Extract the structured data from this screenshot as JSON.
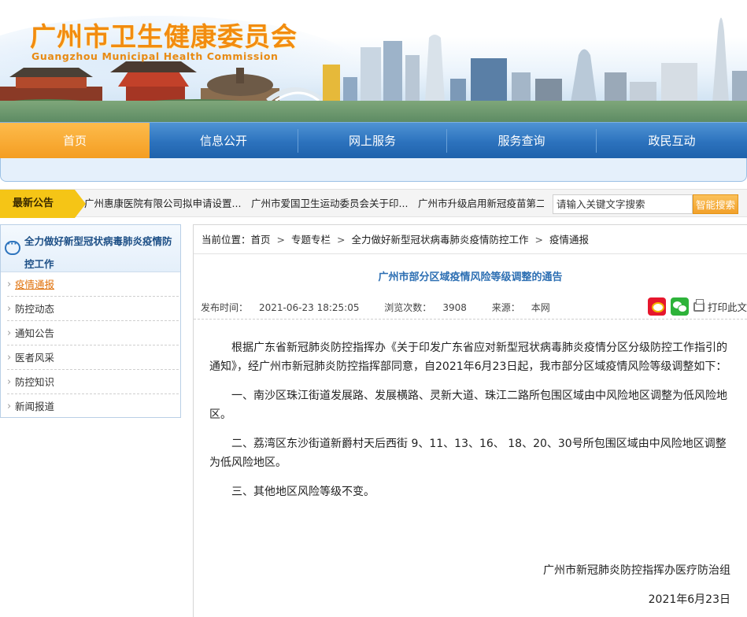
{
  "header": {
    "site_title": "广州市卫生健康委员会",
    "site_subtitle": "Guangzhou Municipal Health Commission"
  },
  "nav": {
    "items": [
      {
        "label": "首页",
        "active": true
      },
      {
        "label": "信息公开",
        "active": false
      },
      {
        "label": "网上服务",
        "active": false
      },
      {
        "label": "服务查询",
        "active": false
      },
      {
        "label": "政民互动",
        "active": false
      }
    ]
  },
  "notice": {
    "label": "最新公告",
    "items": [
      "广州惠康医院有限公司拟申请设置...",
      "广州市爱国卫生运动委员会关于印...",
      "广州市升级启用新冠疫苗第二"
    ]
  },
  "search": {
    "placeholder": "请输入关键文字搜索",
    "button_label": "智能搜索"
  },
  "sidebar": {
    "heading": "全力做好新型冠状病毒肺炎疫情防控工作",
    "items": [
      {
        "label": "疫情通报",
        "active": true
      },
      {
        "label": "防控动态",
        "active": false
      },
      {
        "label": "通知公告",
        "active": false
      },
      {
        "label": "医者风采",
        "active": false
      },
      {
        "label": "防控知识",
        "active": false
      },
      {
        "label": "新闻报道",
        "active": false
      }
    ]
  },
  "breadcrumb": {
    "prefix": "当前位置：",
    "items": [
      "首页",
      "专题专栏",
      "全力做好新型冠状病毒肺炎疫情防控工作",
      "疫情通报"
    ],
    "separator": ">"
  },
  "article": {
    "title": "广州市部分区域疫情风险等级调整的通告",
    "publish_label": "发布时间：",
    "publish_time": "2021-06-23 18:25:05",
    "views_label": "浏览次数：",
    "views": "3908",
    "source_label": "来源：",
    "source": "本网",
    "print_label": "打印此文",
    "paragraphs": [
      "根据广东省新冠肺炎防控指挥办《关于印发广东省应对新型冠状病毒肺炎疫情分区分级防控工作指引的通知》，经广州市新冠肺炎防控指挥部同意，自2021年6月23日起，我市部分区域疫情风险等级调整如下：",
      "一、南沙区珠江街道发展路、发展横路、灵新大道、珠江二路所包围区域由中风险地区调整为低风险地区。",
      "二、荔湾区东沙街道新爵村天后西街 9、11、13、16、 18、20、30号所包围区域由中风险地区调整为低风险地区。",
      "三、其他地区风险等级不变。"
    ],
    "signature_org": "广州市新冠肺炎防控指挥办医疗防治组",
    "signature_date": "2021年6月23日"
  },
  "colors": {
    "nav_blue": "#2c72bd",
    "nav_active": "#f49d21",
    "title_orange": "#f28c0f",
    "link_blue": "#2d6fb3",
    "notice_yellow": "#f5c516"
  }
}
